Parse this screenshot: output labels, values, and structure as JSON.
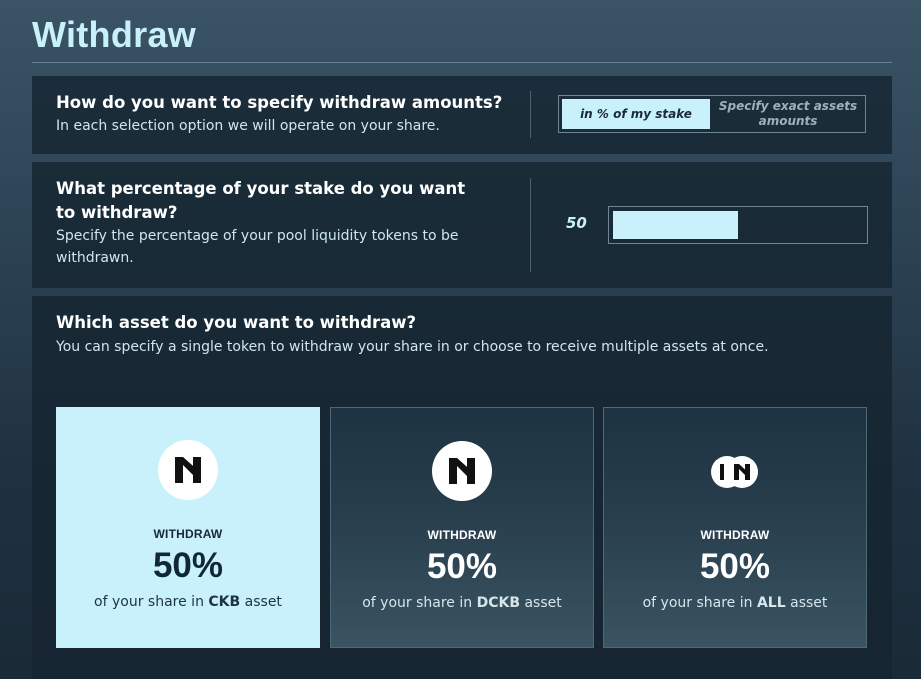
{
  "page": {
    "title": "Withdraw"
  },
  "mode": {
    "question": "How do you want to specify withdraw amounts?",
    "subtitle": "In each selection option we will operate on your share.",
    "options": [
      {
        "label": "in % of my stake",
        "selected": true
      },
      {
        "label": "Specify exact assets amounts",
        "selected": false
      }
    ]
  },
  "percentage": {
    "question": "What percentage of your stake do you want to withdraw?",
    "subtitle": "Specify the percentage of your pool liquidity tokens to be withdrawn.",
    "value": "50",
    "fill_percent": 50
  },
  "asset_selection": {
    "question": "Which asset do you want to withdraw?",
    "subtitle": "You can specify a single token to withdraw your share in or choose to receive multiple assets at once.",
    "assets": [
      {
        "action_label": "WITHDRAW",
        "percent": "50%",
        "desc_prefix": "of your share in",
        "asset": "CKB",
        "desc_suffix": "asset",
        "icon": "nervos-ckb-icon",
        "selected": true
      },
      {
        "action_label": "WITHDRAW",
        "percent": "50%",
        "desc_prefix": "of your share in",
        "asset": "DCKB",
        "desc_suffix": "asset",
        "icon": "nervos-dckb-icon",
        "selected": false
      },
      {
        "action_label": "WITHDRAW",
        "percent": "50%",
        "desc_prefix": "of your share in",
        "asset": "ALL",
        "desc_suffix": "asset",
        "icon": "all-assets-icon",
        "selected": false
      }
    ]
  },
  "colors": {
    "accent": "#c8f1fb",
    "card_bg": "#152430",
    "dark_text": "#18293a"
  }
}
